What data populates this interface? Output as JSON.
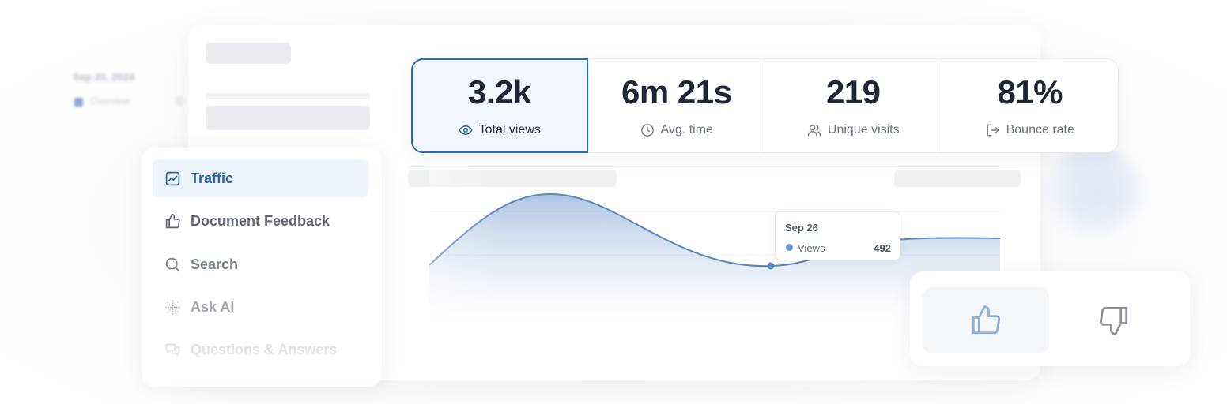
{
  "background": {
    "date": "Sep 25, 2024",
    "legend": [
      "Overview",
      "32"
    ]
  },
  "stats": [
    {
      "value": "3.2k",
      "label": "Total views",
      "icon": "eye-icon",
      "active": true
    },
    {
      "value": "6m 21s",
      "label": "Avg. time",
      "icon": "clock-icon",
      "active": false
    },
    {
      "value": "219",
      "label": "Unique visits",
      "icon": "users-icon",
      "active": false
    },
    {
      "value": "81%",
      "label": "Bounce rate",
      "icon": "log-out-icon",
      "active": false
    }
  ],
  "nav": {
    "items": [
      {
        "label": "Traffic",
        "icon": "chart-line-icon",
        "active": true
      },
      {
        "label": "Document Feedback",
        "icon": "thumbs-up-icon",
        "active": false
      },
      {
        "label": "Search",
        "icon": "search-icon",
        "active": false
      },
      {
        "label": "Ask AI",
        "icon": "sparkle-dots-icon",
        "active": false
      },
      {
        "label": "Questions & Answers",
        "icon": "chat-bubbles-icon",
        "active": false
      }
    ]
  },
  "tooltip": {
    "date": "Sep 26",
    "series": "Views",
    "value": "492"
  },
  "colors": {
    "accent": "#2a6bb6",
    "line": "#5b87c0",
    "active_bg": "#eef4fb"
  },
  "feedback": {
    "up_icon": "thumbs-up-icon",
    "down_icon": "thumbs-down-icon"
  }
}
